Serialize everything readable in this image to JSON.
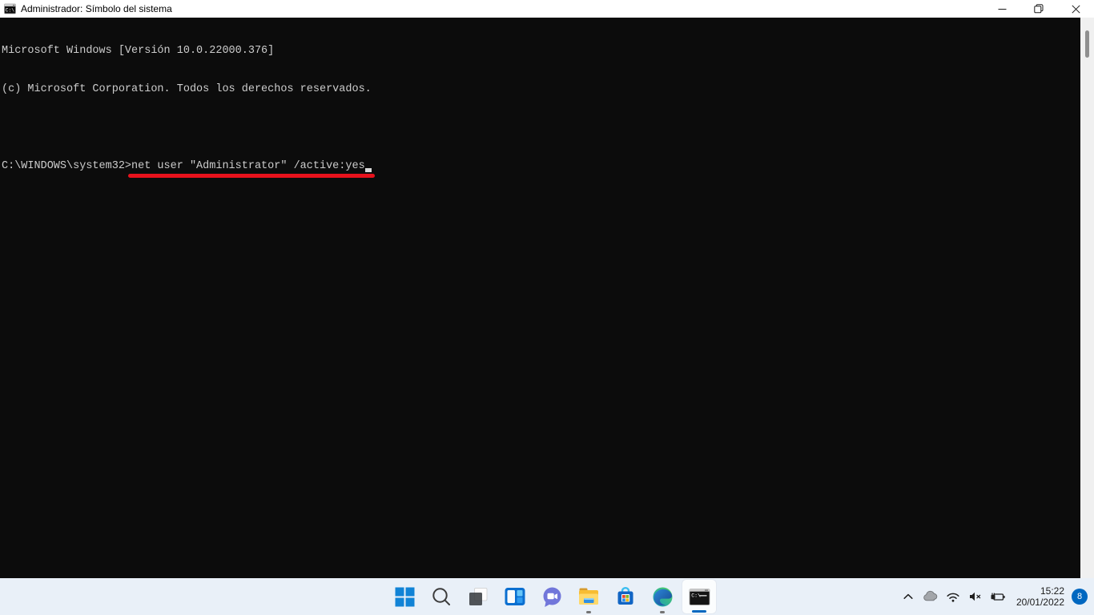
{
  "window": {
    "title": "Administrador: Símbolo del sistema",
    "controls": {
      "minimize": "Minimizar",
      "restore": "Restaurar",
      "close": "Cerrar"
    }
  },
  "terminal": {
    "background": "#0c0c0c",
    "text_color": "#cccccc",
    "line1": "Microsoft Windows [Versión 10.0.22000.376]",
    "line2": "(c) Microsoft Corporation. Todos los derechos reservados.",
    "prompt": "C:\\WINDOWS\\system32>",
    "command": "net user \"Administrator\" /active:yes",
    "annotation_color": "#e8121c"
  },
  "taskbar": {
    "background": "#e9f0f8",
    "items": [
      {
        "name": "start",
        "label": "Inicio"
      },
      {
        "name": "search",
        "label": "Búsqueda"
      },
      {
        "name": "task-view",
        "label": "Vista de tareas"
      },
      {
        "name": "widgets",
        "label": "Widgets"
      },
      {
        "name": "chat",
        "label": "Chat"
      },
      {
        "name": "file-explorer",
        "label": "Explorador de archivos",
        "running": true
      },
      {
        "name": "microsoft-store",
        "label": "Microsoft Store"
      },
      {
        "name": "microsoft-edge",
        "label": "Microsoft Edge",
        "running": true
      },
      {
        "name": "command-prompt",
        "label": "Símbolo del sistema",
        "active": true
      }
    ],
    "tray": {
      "icons": [
        "hidden-icons-chevron",
        "onedrive-cloud",
        "wifi",
        "volume-muted",
        "battery-charging"
      ],
      "time": "15:22",
      "date": "20/01/2022",
      "notification_count": "8",
      "badge_color": "#0067c0"
    }
  }
}
